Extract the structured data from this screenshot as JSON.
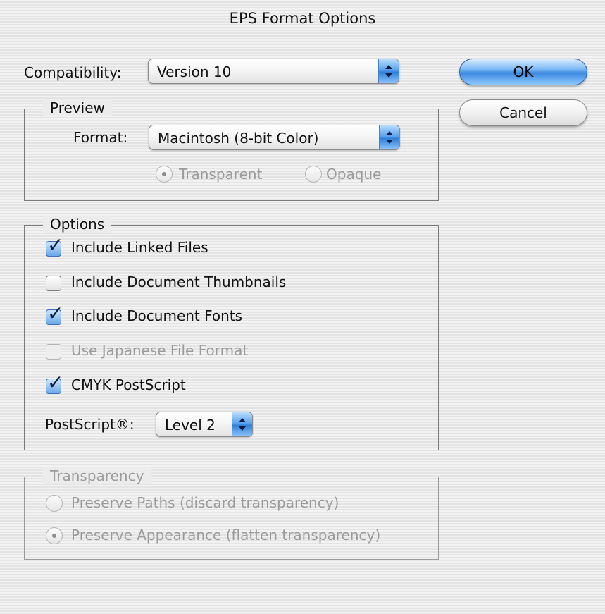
{
  "dialog": {
    "title": "EPS Format Options"
  },
  "compatibility": {
    "label": "Compatibility:",
    "value": "Version 10"
  },
  "buttons": {
    "ok": "OK",
    "cancel": "Cancel"
  },
  "preview": {
    "legend": "Preview",
    "format_label": "Format:",
    "format_value": "Macintosh (8-bit Color)",
    "radios": [
      {
        "label": "Transparent",
        "selected": true,
        "enabled": false
      },
      {
        "label": "Opaque",
        "selected": false,
        "enabled": false
      }
    ]
  },
  "options": {
    "legend": "Options",
    "checkboxes": [
      {
        "label": "Include Linked Files",
        "checked": true,
        "enabled": true
      },
      {
        "label": "Include Document Thumbnails",
        "checked": false,
        "enabled": true
      },
      {
        "label": "Include Document Fonts",
        "checked": true,
        "enabled": true
      },
      {
        "label": "Use Japanese File Format",
        "checked": false,
        "enabled": false
      },
      {
        "label": "CMYK PostScript",
        "checked": true,
        "enabled": true
      }
    ],
    "postscript_label": "PostScript®:",
    "postscript_value": "Level 2"
  },
  "transparency": {
    "legend": "Transparency",
    "radios": [
      {
        "label": "Preserve Paths (discard transparency)",
        "selected": false,
        "enabled": false
      },
      {
        "label": "Preserve Appearance (flatten transparency)",
        "selected": true,
        "enabled": false
      }
    ]
  },
  "icons": {
    "popup_arrows": "updown-arrows-icon",
    "checkmark": "checkmark-icon"
  },
  "colors": {
    "accent_blue": "#3d8ae0",
    "disabled_text": "#9b9b9b"
  }
}
